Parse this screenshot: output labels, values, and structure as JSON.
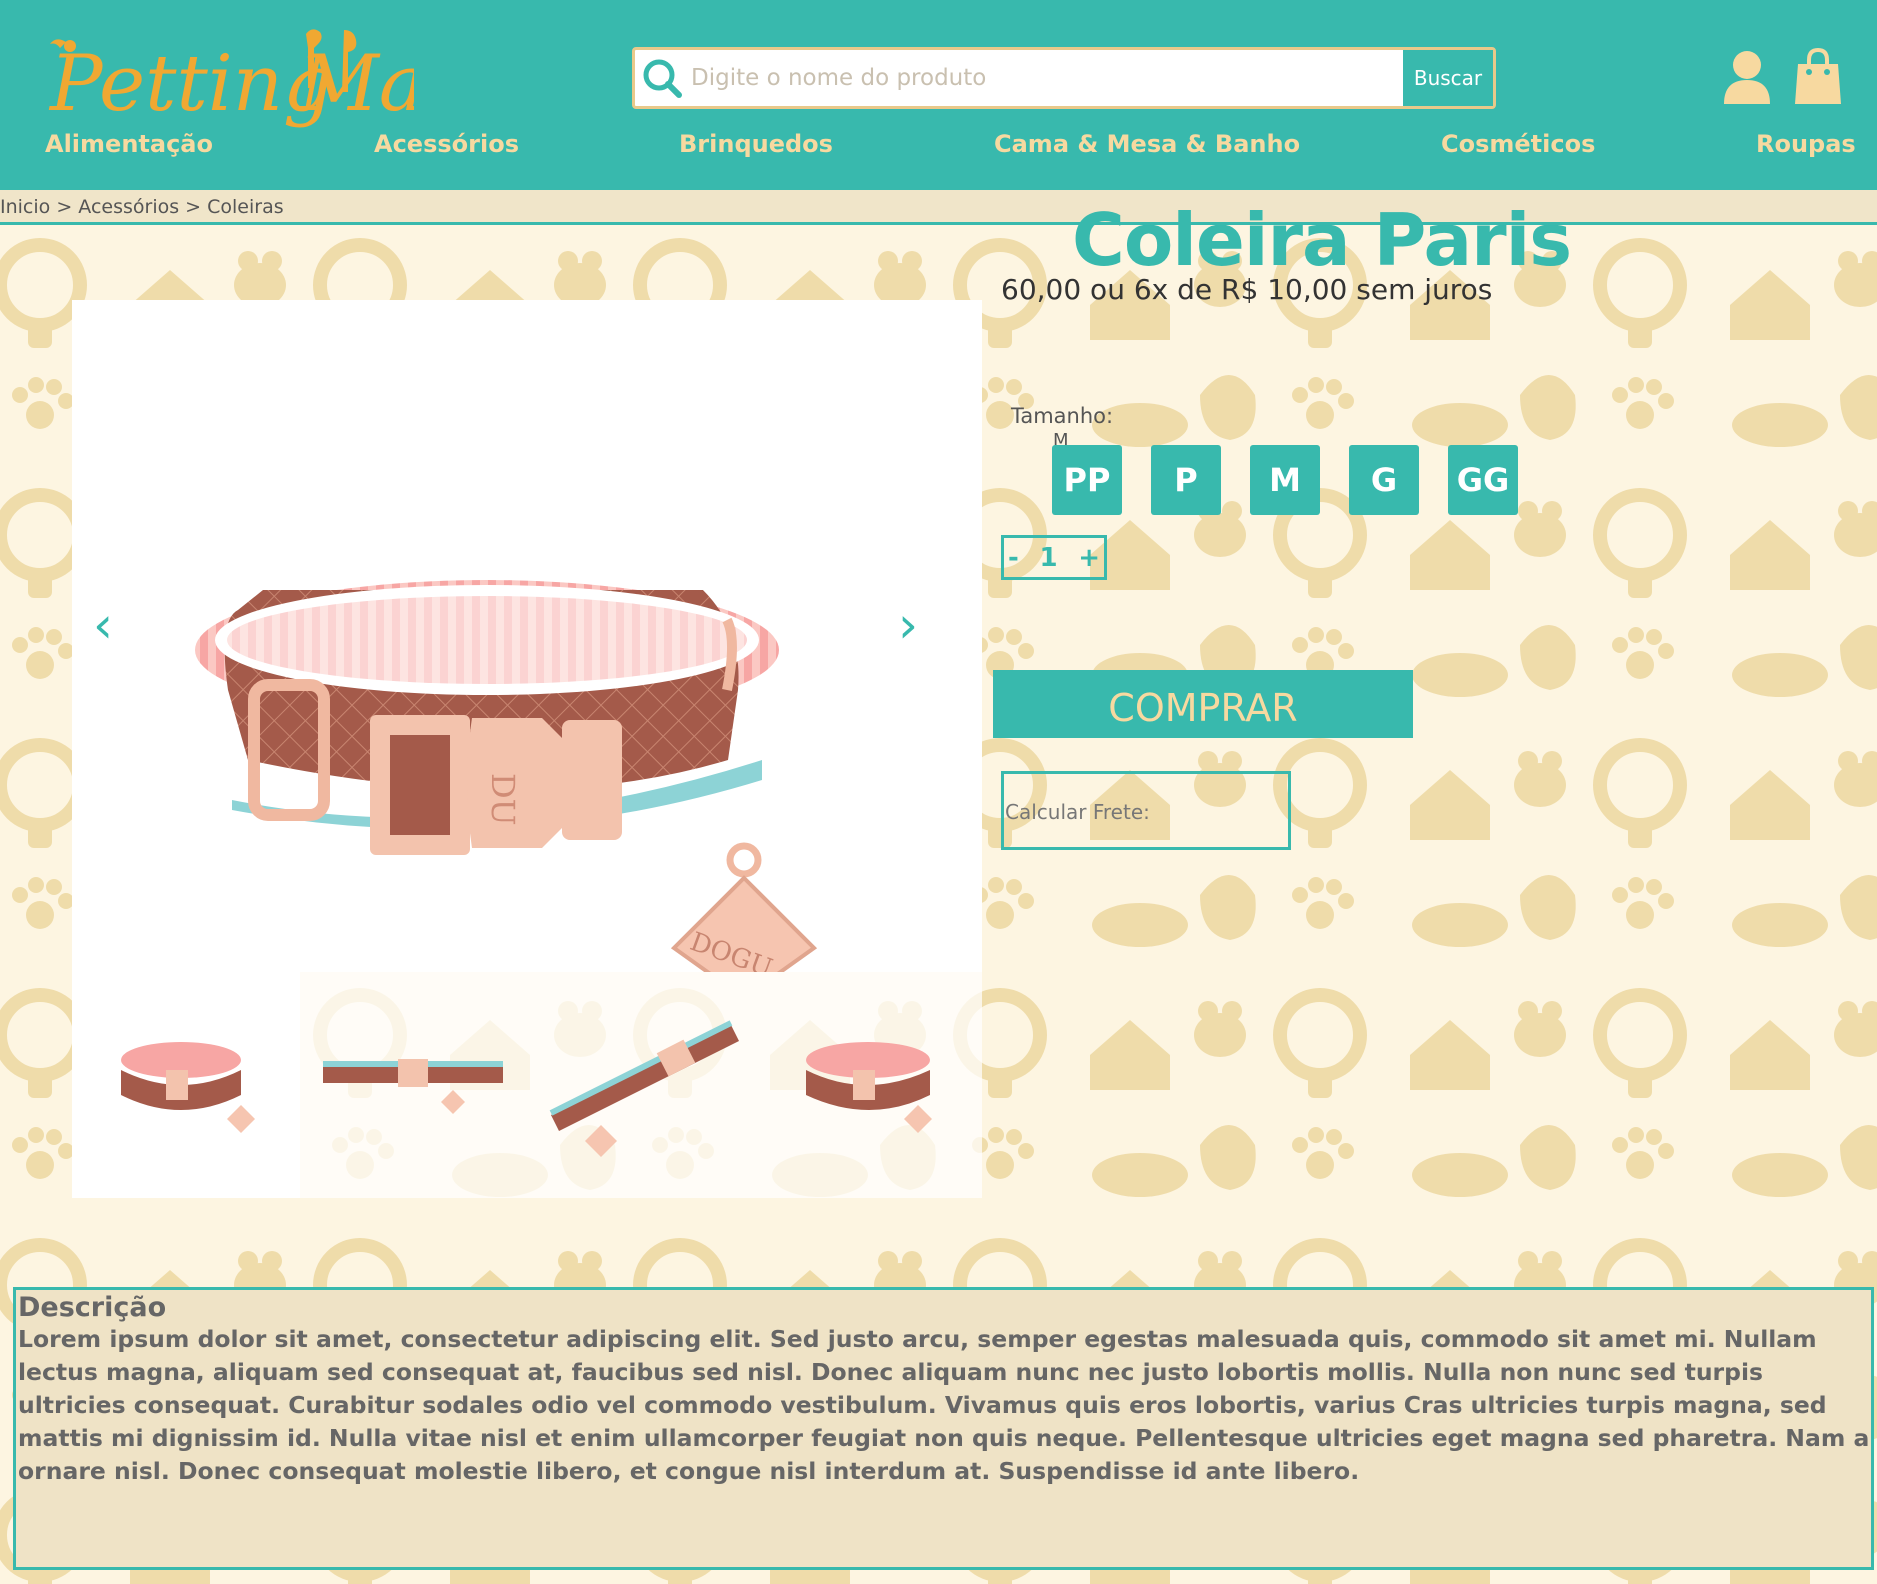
{
  "header": {
    "logo_text": "PettingMall",
    "search": {
      "placeholder": "Digite o nome do produto",
      "button": "Buscar"
    },
    "nav": [
      "Alimentação",
      "Acessórios",
      "Brinquedos",
      "Cama & Mesa & Banho",
      "Cosméticos",
      "Roupas"
    ]
  },
  "breadcrumb": [
    "Inicio",
    "Acessórios",
    "Coleiras"
  ],
  "breadcrumb_separator": " > ",
  "product": {
    "title": "Coleira Paris",
    "price": "60,00 ou 6x de R$ 10,00 sem juros",
    "size_label": "Tamanho:",
    "size_selected": "M",
    "sizes": [
      "PP",
      "P",
      "M",
      "G",
      "GG"
    ],
    "qty_minus": "-",
    "qty_value": "1",
    "qty_plus": "+",
    "buy_label": "COMPRAR",
    "frete_label": "Calcular Frete:"
  },
  "gallery": {
    "prev": "‹",
    "next": "›",
    "thumb_count": 4
  },
  "description": {
    "title": "Descrição",
    "text": "Lorem ipsum dolor sit amet, consectetur adipiscing elit. Sed justo arcu, semper egestas malesuada quis, commodo sit amet mi. Nullam lectus magna, aliquam sed consequat at, faucibus sed nisl. Donec aliquam nunc nec justo lobortis mollis. Nulla non nunc sed turpis ultricies consequat. Curabitur sodales odio vel commodo vestibulum. Vivamus quis eros lobortis, varius Cras ultricies turpis magna, sed mattis mi dignissim id. Nulla vitae nisl et enim ullamcorper feugiat non quis neque. Pellentesque ultricies eget magna sed pharetra. Nam a ornare nisl. Donec consequat molestie libero, et congue nisl interdum at. Suspendisse id ante libero."
  },
  "colors": {
    "teal": "#38b9ad",
    "gold": "#f7d9a0",
    "cream": "#fdf5e1"
  }
}
